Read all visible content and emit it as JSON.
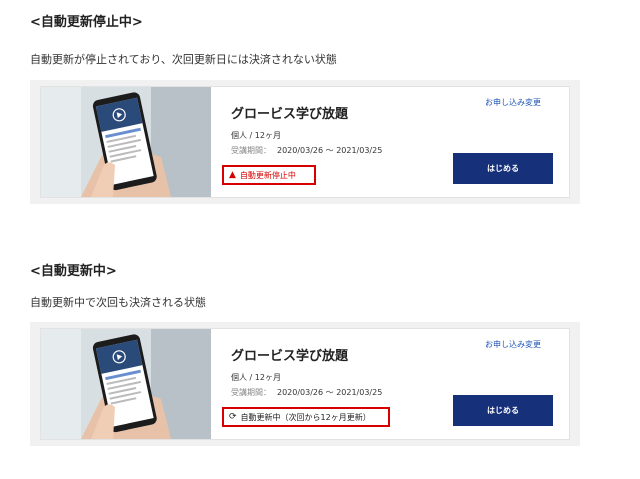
{
  "sections": [
    {
      "heading": "<自動更新停止中>",
      "description": "自動更新が停止されており、次回更新日には決済されない状態",
      "card": {
        "title": "グロービス学び放題",
        "plan": "個人 / 12ヶ月",
        "period_label": "受講期間：",
        "period_value": "2020/03/26 〜 2021/03/25",
        "status_text": "自動更新停止中",
        "status_icon": "warning-icon",
        "change_link": "お申し込み変更",
        "start_button": "はじめる"
      }
    },
    {
      "heading": "<自動更新中>",
      "description": "自動更新中で次回も決済される状態",
      "card": {
        "title": "グロービス学び放題",
        "plan": "個人 / 12ヶ月",
        "period_label": "受講期間：",
        "period_value": "2020/03/26 〜 2021/03/25",
        "status_text": "自動更新中（次回から12ヶ月更新）",
        "status_icon": "refresh-icon",
        "change_link": "お申し込み変更",
        "start_button": "はじめる"
      }
    }
  ],
  "colors": {
    "button": "#17307a",
    "link": "#1e55b8",
    "highlight_border": "#d60000",
    "section_bg": "#f1f1f1"
  }
}
